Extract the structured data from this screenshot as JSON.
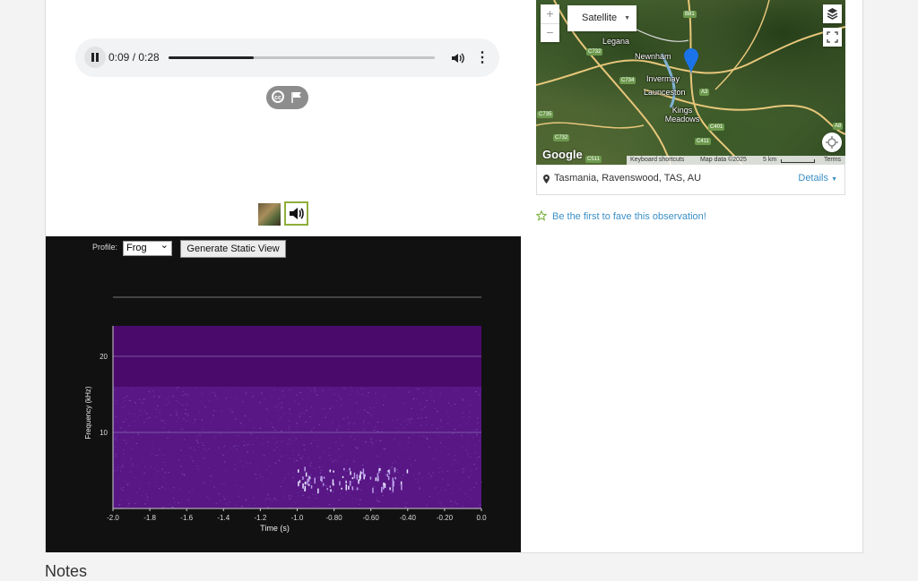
{
  "audio": {
    "time_display": "0:09 / 0:28",
    "progress_fraction": 0.32,
    "pause_icon": "pause-icon",
    "volume_icon": "volume-icon",
    "menu_icon": "more-vert-icon"
  },
  "license": {
    "cc_icon": "cc-icon",
    "cc_text": "cc",
    "flag_icon": "flag-icon"
  },
  "media_thumbs": {
    "photo_icon": "photo-thumbnail",
    "sound_icon": "speaker-icon"
  },
  "spectrogram": {
    "profile_label": "Profile:",
    "profile_value": "Frog",
    "generate_button": "Generate Static View"
  },
  "chart_data": {
    "type": "heatmap",
    "title": "",
    "xlabel": "Time (s)",
    "ylabel": "Frequency (kHz)",
    "x_ticks": [
      "-2.0",
      "-1.8",
      "-1.6",
      "-1.4",
      "-1.2",
      "-1.0",
      "-0.80",
      "-0.60",
      "-0.40",
      "-0.20",
      "0.0"
    ],
    "y_ticks": [
      "10",
      "20"
    ],
    "xlim": [
      -2.0,
      0.0
    ],
    "ylim": [
      0,
      24
    ],
    "grid": true,
    "colormap": "purple-plasma"
  },
  "map": {
    "map_type": "Satellite",
    "zoom_in": "+",
    "zoom_out": "−",
    "labels": [
      "Legana",
      "Newnham",
      "Invermay",
      "Launceston",
      "Kings Meadows"
    ],
    "roads": [
      "C732",
      "C734",
      "A3",
      "C401",
      "C411",
      "C735",
      "C511",
      "B81",
      "A3",
      "A8",
      "C732"
    ],
    "google": "Google",
    "attribution": {
      "shortcuts": "Keyboard shortcuts",
      "data": "Map data ©2025",
      "scale": "5 km",
      "terms": "Terms"
    }
  },
  "location": {
    "text": "Tasmania, Ravenswood, TAS, AU",
    "details": "Details"
  },
  "fave": {
    "text": "Be the first to fave this observation!"
  },
  "notes": {
    "heading": "Notes"
  },
  "colors": {
    "link": "#3a8fc7",
    "accent_green": "#8fae3a",
    "pin": "#1a73e8"
  }
}
